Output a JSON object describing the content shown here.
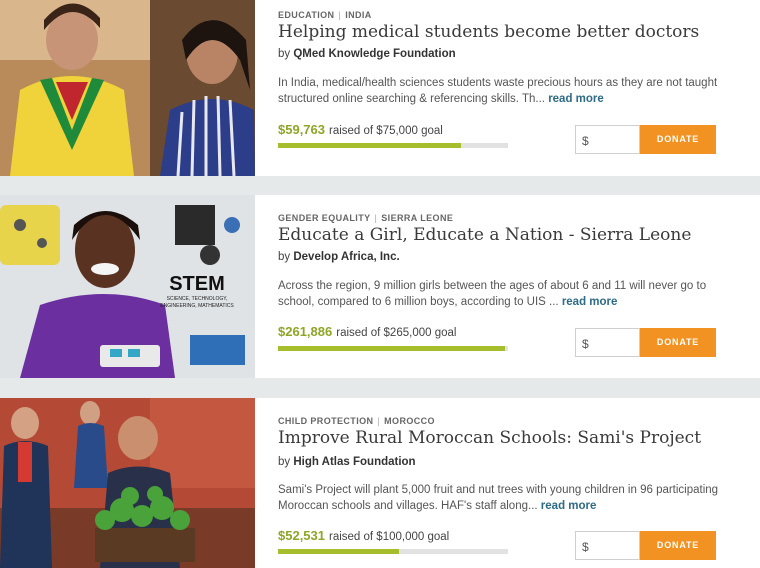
{
  "projects": [
    {
      "tags": [
        "EDUCATION",
        "INDIA"
      ],
      "title": "Helping medical students become better doctors",
      "org_prefix": "by",
      "org": "QMed Knowledge Foundation",
      "description": "In India, medical/health sciences students waste precious hours as they are not taught structured online searching & referencing skills. Th...",
      "more": "read more",
      "raised": "$59,763",
      "goal_text": "raised of $75,000 goal",
      "progress": 0.797,
      "currency": "$",
      "donate": "DONATE"
    },
    {
      "tags": [
        "GENDER EQUALITY",
        "SIERRA LEONE"
      ],
      "title": "Educate a Girl, Educate a Nation - Sierra Leone",
      "org_prefix": "by",
      "org": "Develop Africa, Inc.",
      "description": "Across the region, 9 million girls between the ages of about 6 and 11 will never go to school, compared to 6 million boys, according to UIS ...",
      "more": "read more",
      "raised": "$261,886",
      "goal_text": "raised of $265,000 goal",
      "progress": 0.988,
      "currency": "$",
      "donate": "DONATE",
      "image_text": {
        "stem": "STEM",
        "stem_sub1": "SCIENCE, TECHNOLOGY,",
        "stem_sub2": "ENGINEERING, MATHEMATICS"
      }
    },
    {
      "tags": [
        "CHILD PROTECTION",
        "MOROCCO"
      ],
      "title": "Improve Rural Moroccan Schools: Sami's Project",
      "org_prefix": "by",
      "org": "High Atlas Foundation",
      "description": "Sami's Project will plant 5,000 fruit and nut trees with young children in 96 participating Moroccan schools and villages. HAF's staff along...",
      "more": "read more",
      "raised": "$52,531",
      "goal_text": "raised of $100,000 goal",
      "progress": 0.525,
      "currency": "$",
      "donate": "DONATE"
    }
  ],
  "colors": {
    "accent": "#f29222",
    "progress": "#a7be2c",
    "raised": "#8da626",
    "link": "#2d6b86"
  }
}
